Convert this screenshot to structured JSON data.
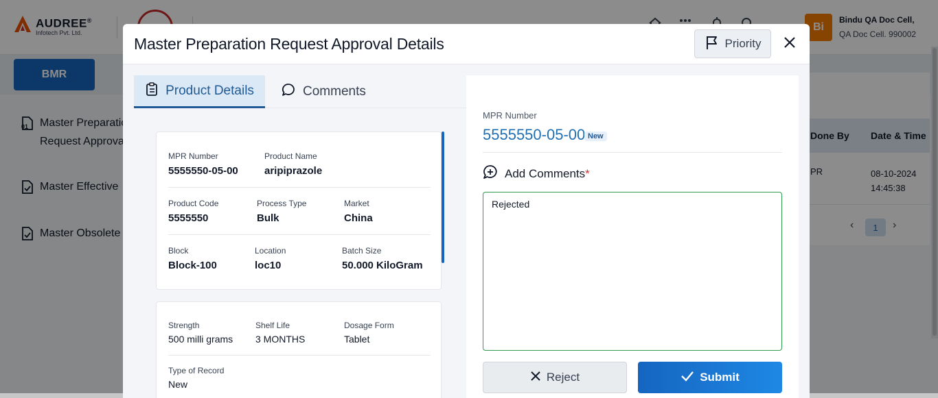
{
  "app": {
    "brand_name": "AUDREE",
    "brand_registered": "®",
    "brand_sub": "Infotech Pvt. Ltd.",
    "user_initials": "Bi",
    "user_name": "Bindu QA Doc Cell,",
    "user_role": "QA Doc Cell. 990002",
    "module_button": "BMR",
    "sidebar": [
      {
        "label_line1": "Master Preparation",
        "label_line2": "Request Approval"
      },
      {
        "label_line1": "Master Effective",
        "label_line2": ""
      },
      {
        "label_line1": "Master Obsolete",
        "label_line2": ""
      }
    ],
    "table": {
      "col_done_by": "Done By",
      "col_date_time": "Date & Time",
      "row_done_by": "PR",
      "row_date": "08-10-2024",
      "row_time": "14:45:38"
    },
    "pagination": {
      "current": "1",
      "prev": "‹",
      "next": "›"
    }
  },
  "modal": {
    "title": "Master Preparation Request Approval Details",
    "priority_label": "Priority",
    "close_glyph": "✕",
    "tabs": {
      "product_details": "Product Details",
      "comments": "Comments"
    },
    "details": {
      "mpr_number_label": "MPR Number",
      "mpr_number": "5555550-05-00",
      "product_name_label": "Product Name",
      "product_name": "aripiprazole",
      "product_code_label": "Product Code",
      "product_code": "5555550",
      "process_type_label": "Process Type",
      "process_type": "Bulk",
      "market_label": "Market",
      "market": "China",
      "block_label": "Block",
      "block": "Block-100",
      "location_label": "Location",
      "location": "loc10",
      "batch_size_label": "Batch Size",
      "batch_size": "50.000 KiloGram",
      "strength_label": "Strength",
      "strength": "500 milli grams",
      "shelf_life_label": "Shelf Life",
      "shelf_life": "3 MONTHS",
      "dosage_form_label": "Dosage Form",
      "dosage_form": "Tablet",
      "type_of_record_label": "Type of Record",
      "type_of_record": "New"
    },
    "form": {
      "mpr_number_label": "MPR Number",
      "mpr_number": "5555550-05-00",
      "status_badge": "New",
      "add_comments_label": "Add Comments",
      "required_mark": "*",
      "comment_value": "Rejected",
      "reject_label": "Reject",
      "submit_label": "Submit"
    }
  }
}
